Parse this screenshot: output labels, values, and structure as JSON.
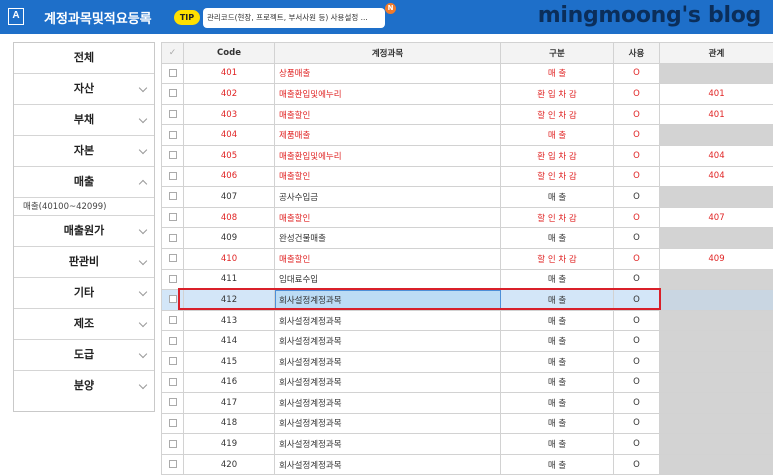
{
  "header": {
    "app_icon": "A",
    "title": "계정과목및적요등록",
    "tip_label": "TIP",
    "tip_text": "관리코드(현장, 프로젝트, 부서사원 등) 사용설정 ...",
    "tip_badge": "N",
    "brand": "mingmoong's blog"
  },
  "sidebar": {
    "items": [
      {
        "label": "전체"
      },
      {
        "label": "자산"
      },
      {
        "label": "부채"
      },
      {
        "label": "자본"
      },
      {
        "label": "매출"
      },
      {
        "label": "매출원가"
      },
      {
        "label": "판관비"
      },
      {
        "label": "기타"
      },
      {
        "label": "제조"
      },
      {
        "label": "도급"
      },
      {
        "label": "분양"
      }
    ],
    "sub_range": "매출(40100~42099)"
  },
  "table": {
    "headers": [
      "Code",
      "계정과목",
      "구분",
      "사용",
      "관계"
    ],
    "rows": [
      {
        "code": "401",
        "name": "상품매출",
        "type": "매 출",
        "use": "O",
        "rel": ""
      },
      {
        "code": "402",
        "name": "매출환입및에누리",
        "type": "환 입 차 감",
        "use": "O",
        "rel": "401"
      },
      {
        "code": "403",
        "name": "매출할인",
        "type": "할 인 차 감",
        "use": "O",
        "rel": "401"
      },
      {
        "code": "404",
        "name": "제품매출",
        "type": "매 출",
        "use": "O",
        "rel": ""
      },
      {
        "code": "405",
        "name": "매출환입및에누리",
        "type": "환 입 차 감",
        "use": "O",
        "rel": "404"
      },
      {
        "code": "406",
        "name": "매출할인",
        "type": "할 인 차 감",
        "use": "O",
        "rel": "404"
      },
      {
        "code": "407",
        "name": "공사수입금",
        "type": "매 출",
        "use": "O",
        "rel": ""
      },
      {
        "code": "408",
        "name": "매출할인",
        "type": "할 인 차 감",
        "use": "O",
        "rel": "407"
      },
      {
        "code": "409",
        "name": "완성건물매출",
        "type": "매 출",
        "use": "O",
        "rel": ""
      },
      {
        "code": "410",
        "name": "매출할인",
        "type": "할 인 차 감",
        "use": "O",
        "rel": "409"
      },
      {
        "code": "411",
        "name": "임대료수입",
        "type": "매 출",
        "use": "O",
        "rel": ""
      },
      {
        "code": "412",
        "name": "회사설정계정과목",
        "type": "매 출",
        "use": "O",
        "rel": ""
      },
      {
        "code": "413",
        "name": "회사설정계정과목",
        "type": "매 출",
        "use": "O",
        "rel": ""
      },
      {
        "code": "414",
        "name": "회사설정계정과목",
        "type": "매 출",
        "use": "O",
        "rel": ""
      },
      {
        "code": "415",
        "name": "회사설정계정과목",
        "type": "매 출",
        "use": "O",
        "rel": ""
      },
      {
        "code": "416",
        "name": "회사설정계정과목",
        "type": "매 출",
        "use": "O",
        "rel": ""
      },
      {
        "code": "417",
        "name": "회사설정계정과목",
        "type": "매 출",
        "use": "O",
        "rel": ""
      },
      {
        "code": "418",
        "name": "회사설정계정과목",
        "type": "매 출",
        "use": "O",
        "rel": ""
      },
      {
        "code": "419",
        "name": "회사설정계정과목",
        "type": "매 출",
        "use": "O",
        "rel": ""
      },
      {
        "code": "420",
        "name": "회사설정계정과목",
        "type": "매 출",
        "use": "O",
        "rel": ""
      }
    ],
    "red_rows": [
      0,
      1,
      2,
      3,
      4,
      5,
      7,
      9
    ],
    "gray_rel_rows": [
      0,
      3,
      6,
      8,
      10,
      11,
      12,
      13,
      14,
      15,
      16,
      17,
      18,
      19
    ],
    "selected_row": 11
  },
  "colors": {
    "header_bg": "#1e6fc9",
    "tip_yellow": "#ffe000",
    "brand": "#0b2e5a",
    "red_text": "#e02424",
    "highlight": "#d9202a"
  }
}
